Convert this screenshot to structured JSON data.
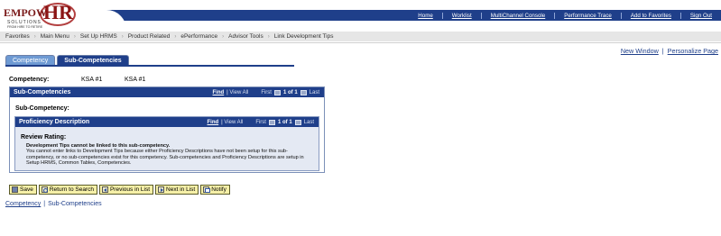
{
  "logo": {
    "brand_left": "EMPOW",
    "brand_right": "HR",
    "solutions": "SOLUTIONS",
    "tagline": "FROM HIRE TO RETIRE"
  },
  "topnav": [
    "Home",
    "Worklist",
    "MultiChannel Console",
    "Performance Trace",
    "Add to Favorites",
    "Sign Out"
  ],
  "menubar": [
    "Favorites",
    "Main Menu",
    "Set Up HRMS",
    "Product Related",
    "ePerformance",
    "Advisor Tools",
    "Link Development Tips"
  ],
  "menubar_separator": "›",
  "right_links": {
    "new_window": "New Window",
    "separator": "|",
    "personalize": "Personalize Page"
  },
  "tabs": [
    {
      "label": "Competency",
      "active": false
    },
    {
      "label": "Sub-Competencies",
      "active": true
    }
  ],
  "competency": {
    "label": "Competency:",
    "value1": "KSA #1",
    "value2": "KSA #1"
  },
  "subcomp_grid": {
    "title": "Sub-Competencies",
    "find": "Find",
    "view_all": "View All",
    "first": "First",
    "count": "1 of 1",
    "last": "Last",
    "field_label": "Sub-Competency:"
  },
  "prof_grid": {
    "title": "Proficiency Description",
    "find": "Find",
    "view_all": "View All",
    "first": "First",
    "count": "1 of 1",
    "last": "Last",
    "review_label": "Review Rating:",
    "message_bold": "Development Tips cannot be linked to this sub-competency.",
    "message_body": "You cannot enter links to Development Tips because either Proficiency Descriptions have not been setup for this sub-competency, or no sub-competencies exist for this competency. Sub-competencies and Proficiency Descriptions are setup in Setup HRMS, Common Tables, Competencies."
  },
  "buttons": {
    "save": "Save",
    "return": "Return to Search",
    "previous": "Previous in List",
    "next": "Next in List",
    "notify": "Notify"
  },
  "bottom_links": {
    "competency": "Competency",
    "separator": "|",
    "subcomp": "Sub-Competencies"
  },
  "colors": {
    "header_blue": "#1f3f8a",
    "tab_inactive": "#6e9ad3",
    "button_yellow": "#f6f0a8",
    "panel_bg": "#e4e9f3"
  }
}
